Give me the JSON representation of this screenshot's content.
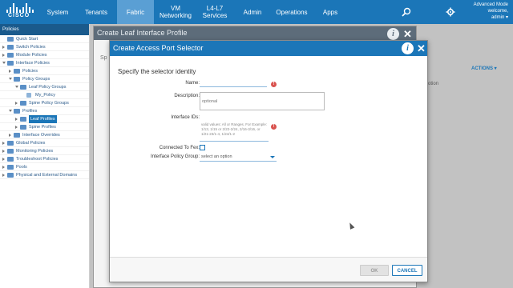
{
  "header": {
    "logo_text": "CISCO",
    "nav": [
      {
        "label": "System"
      },
      {
        "label": "Tenants"
      },
      {
        "label": "Fabric",
        "active": true
      },
      {
        "label": "VM Networking"
      },
      {
        "label": "L4-L7 Services"
      },
      {
        "label": "Admin"
      },
      {
        "label": "Operations"
      },
      {
        "label": "Apps"
      }
    ],
    "mode": "Advanced Mode",
    "welcome": "welcome,",
    "user": "admin"
  },
  "sidebar": {
    "title": "Policies",
    "items": [
      {
        "label": "Quick Start",
        "level": 0,
        "expanded": false,
        "leaf": true
      },
      {
        "label": "Switch Policies",
        "level": 0,
        "expanded": false
      },
      {
        "label": "Module Policies",
        "level": 0,
        "expanded": false
      },
      {
        "label": "Interface Policies",
        "level": 0,
        "expanded": true
      },
      {
        "label": "Policies",
        "level": 1,
        "expanded": false
      },
      {
        "label": "Policy Groups",
        "level": 1,
        "expanded": true
      },
      {
        "label": "Leaf Policy Groups",
        "level": 2,
        "expanded": true
      },
      {
        "label": "My_Policy",
        "level": 3,
        "leaf": true
      },
      {
        "label": "Spine Policy Groups",
        "level": 2,
        "expanded": false
      },
      {
        "label": "Profiles",
        "level": 1,
        "expanded": true
      },
      {
        "label": "Leaf Profiles",
        "level": 2,
        "expanded": false,
        "selected": true
      },
      {
        "label": "Spine Profiles",
        "level": 2,
        "expanded": false
      },
      {
        "label": "Interface Overrides",
        "level": 1,
        "expanded": false
      },
      {
        "label": "Global Policies",
        "level": 0,
        "expanded": false
      },
      {
        "label": "Monitoring Policies",
        "level": 0,
        "expanded": false
      },
      {
        "label": "Troubleshoot Policies",
        "level": 0,
        "expanded": false
      },
      {
        "label": "Pools",
        "level": 0,
        "expanded": false
      },
      {
        "label": "Physical and External Domains",
        "level": 0,
        "expanded": false
      }
    ]
  },
  "background": {
    "actions_label": "ACTIONS",
    "column_fragment": "otion"
  },
  "back_dialog": {
    "title": "Create Leaf Interface Profile",
    "fragment": "Sp"
  },
  "dialog": {
    "title": "Create Access Port Selector",
    "section": "Specify the selector identity",
    "fields": {
      "name_label": "Name:",
      "description_label": "Description:",
      "description_placeholder": "optional",
      "interface_ids_label": "Interface IDs:",
      "interface_ids_hint": "valid values: All or Ranges. For Example: 1/13, 1/15 or 2/22-2/24, 2/16-3/16, or 1/21-23/1-4, 1/24/1-2",
      "connected_to_fex_label": "Connected To Fex:",
      "interface_policy_group_label": "Interface Policy Group:",
      "interface_policy_group_value": "select an option"
    },
    "buttons": {
      "ok": "OK",
      "cancel": "CANCEL"
    }
  }
}
